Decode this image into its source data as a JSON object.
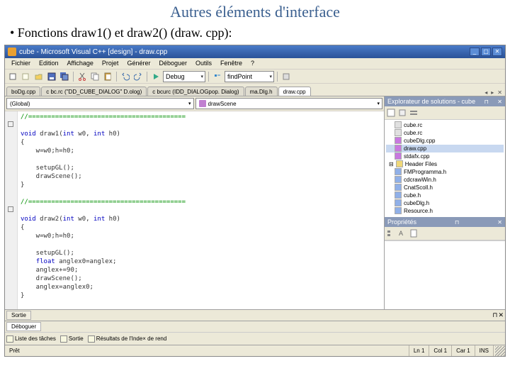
{
  "slide": {
    "title": "Autres éléments d'interface",
    "bullet": "• Fonctions draw1() et draw2() (draw. cpp):"
  },
  "titlebar": "cube - Microsoft Visual C++ [design] - draw.cpp",
  "menu": [
    "Fichier",
    "Edition",
    "Affichage",
    "Projet",
    "Générer",
    "Déboguer",
    "Outils",
    "Fenêtre",
    "?"
  ],
  "toolbar2": {
    "config": "Debug",
    "find": "findPoint"
  },
  "tabs": {
    "items": [
      "boDg.cpp",
      "c bc.rc (\"DD_CUBE_DIALOG\" D.olog)",
      "c bcurc (IDD_DIALOGpop. Dialog)",
      "ma.Dlg.h",
      "draw.cpp"
    ],
    "activeIndex": 4
  },
  "dropdowns": {
    "scope": "(Global)",
    "member": "drawScene"
  },
  "code": "//=========================================\n\nvoid draw1(int w0, int h0)\n{\n    w=w0;h=h0;\n\n    setupGL();\n    drawScene();\n}\n\n//=========================================\n\nvoid draw2(int w0, int h0)\n{\n    w=w0;h=h0;\n\n    setupGL();\n    float anglex0=anglex;\n    anglex+=90;\n    drawScene();\n    anglex=anglex0;\n}",
  "explorer": {
    "title": "Explorateur de solutions - cube",
    "files": [
      "cube.rc",
      "cube.rc",
      "cubeDlg.cpp",
      "draw.cpp",
      "stdafx.cpp"
    ],
    "folder": "Header Files",
    "headers": [
      "FMProgramma.h",
      "cdcrawWin.h",
      "CnatScoll.h",
      "cube.h",
      "cubeDlg.h",
      "Resource.h"
    ]
  },
  "props": {
    "title": "Propriétés"
  },
  "bottom": {
    "tab1": "Sortie",
    "tab2": "Déboguer",
    "items": [
      "Liste des tâches",
      "Sortie",
      "Résultats de l'Inde× de rend"
    ]
  },
  "status": {
    "ready": "Prêt",
    "ln": "Ln 1",
    "col": "Col 1",
    "car": "Car 1",
    "ins": "INS"
  }
}
